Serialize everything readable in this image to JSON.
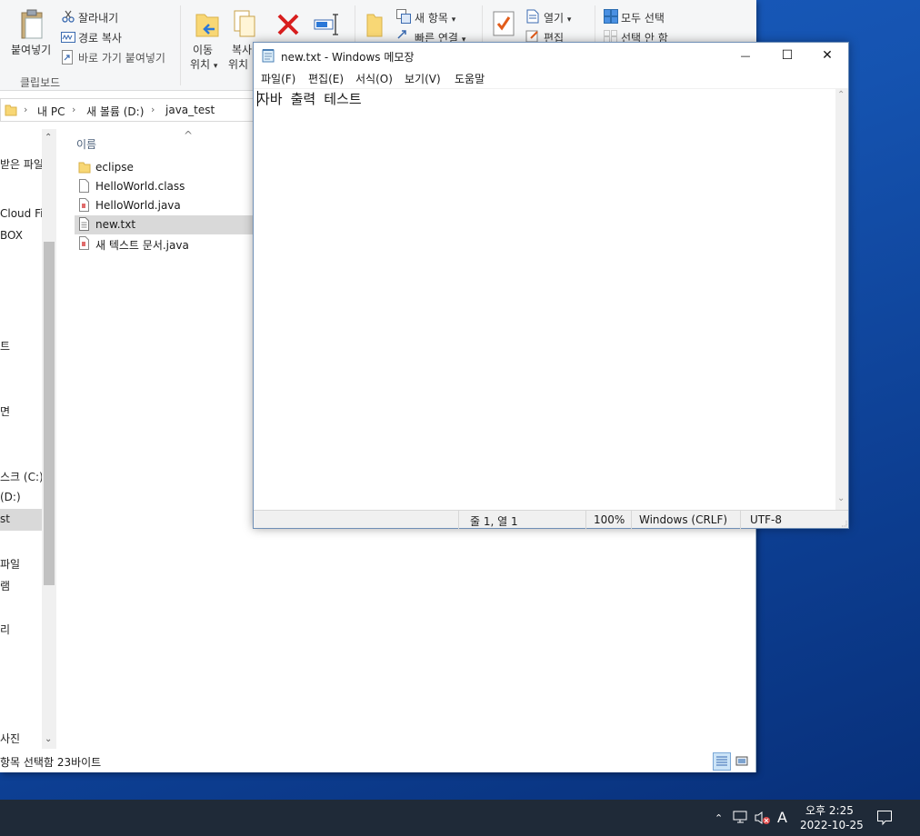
{
  "explorer": {
    "ribbon": {
      "paste_label": "붙여넣기",
      "cut_label": "잘라내기",
      "copy_path_label": "경로 복사",
      "paste_shortcut_label": "바로 가기 붙여넣기",
      "clipboard_group_label": "클립보드",
      "move_to_label_1": "이동",
      "move_to_label_2": "위치",
      "copy_to_label_1": "복사",
      "copy_to_label_2": "위치",
      "new_item_label": "새 항목",
      "easy_access_label": "빠른 연결",
      "open_label": "열기",
      "edit_label": "편집",
      "select_all_label": "모두 선택",
      "select_none_label": "선택 안 함",
      "dropdown_glyph": "▾"
    },
    "address": {
      "crumbs": [
        "내 PC",
        "새 볼륨 (D:)",
        "java_test"
      ],
      "separator": "›"
    },
    "nav": {
      "items": [
        "받은 파일",
        "Cloud File",
        "BOX",
        "트",
        "면",
        "스크 (C:)",
        "(D:)",
        "st",
        "파일",
        "램",
        "리",
        "사진"
      ]
    },
    "filelist": {
      "column_name": "이름",
      "sort_glyph": "^",
      "files": [
        {
          "name": "eclipse",
          "type": "folder"
        },
        {
          "name": "HelloWorld.class",
          "type": "file"
        },
        {
          "name": "HelloWorld.java",
          "type": "java"
        },
        {
          "name": "new.txt",
          "type": "text"
        },
        {
          "name": "새 텍스트 문서.java",
          "type": "java"
        }
      ],
      "selected_index": 3
    },
    "status": {
      "text": "항목 선택함 23바이트"
    }
  },
  "notepad": {
    "title": "new.txt - Windows 메모장",
    "controls": {
      "minimize": "—",
      "maximize": "☐",
      "close": "✕"
    },
    "menu": [
      "파일(F)",
      "편집(E)",
      "서식(O)",
      "보기(V)",
      "도움말"
    ],
    "content": "자바 출력 테스트",
    "status": {
      "position": "줄 1, 열 1",
      "zoom": "100%",
      "line_ending": "Windows (CRLF)",
      "encoding": "UTF-8"
    }
  },
  "taskbar": {
    "time": "오후 2:25",
    "date": "2022-10-25",
    "ime": "A",
    "chevron": "⌃"
  },
  "colors": {
    "desktop": "#1553b0",
    "taskbar": "#1f2a38",
    "selection": "#d9d9d9",
    "folder": "#f8d775",
    "delete_red": "#d81e1e"
  }
}
